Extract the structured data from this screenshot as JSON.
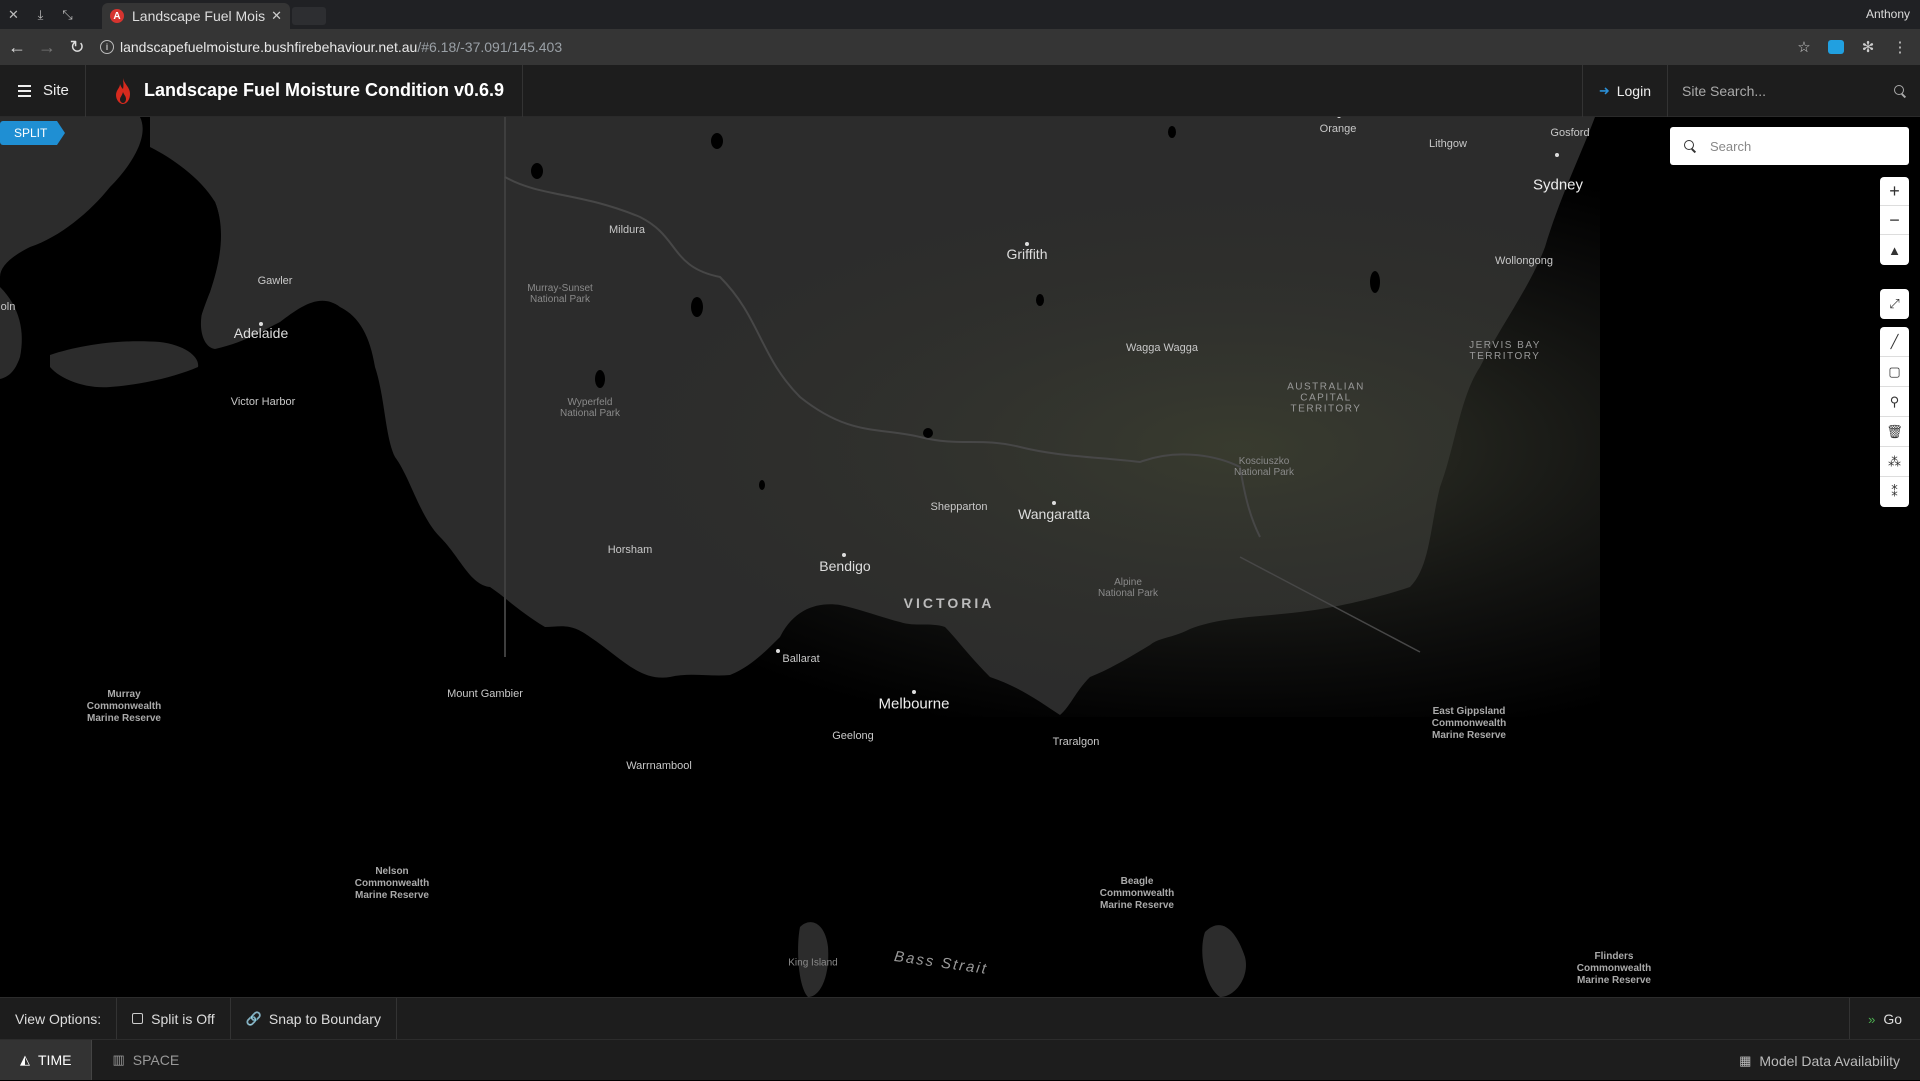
{
  "browser": {
    "tab_title": "Landscape Fuel Moist",
    "tab_favicon_letter": "A",
    "profile_name": "Anthony",
    "url_host": "landscapefuelmoisture.bushfirebehaviour.net.au",
    "url_path": "/#6.18/-37.091/145.403"
  },
  "header": {
    "site_label": "Site",
    "title": "Landscape Fuel Moisture Condition v0.6.9",
    "login_label": "Login",
    "site_search_placeholder": "Site Search...",
    "accent_color": "#1f8fd3"
  },
  "map": {
    "split_badge": "SPLIT",
    "search_placeholder": "Search",
    "controls": [
      "zoom-in-icon",
      "zoom-out-icon",
      "compass-icon",
      "fullscreen-icon",
      "draw-line-icon",
      "draw-polygon-icon",
      "marker-icon",
      "trash-icon",
      "combine-icon",
      "uncombine-icon"
    ],
    "labels": {
      "orange": "Orange",
      "lithgow": "Lithgow",
      "gosford": "Gosford",
      "sydney": "Sydney",
      "wollongong": "Wollongong",
      "mildura": "Mildura",
      "griffith": "Griffith",
      "wagga": "Wagga Wagga",
      "gawler": "Gawler",
      "adelaide": "Adelaide",
      "oln": "oln",
      "victor_harbor": "Victor Harbor",
      "murray_sunset": "Murray-Sunset\nNational Park",
      "wyperfeld": "Wyperfeld\nNational Park",
      "jervis_bay": "JERVIS BAY\nTERRITORY",
      "act": "AUSTRALIAN\nCAPITAL\nTERRITORY",
      "kosciuszko": "Kosciuszko\nNational Park",
      "shepparton": "Shepparton",
      "wangaratta": "Wangaratta",
      "horsham": "Horsham",
      "bendigo": "Bendigo",
      "victoria": "VICTORIA",
      "alpine": "Alpine\nNational Park",
      "ballarat": "Ballarat",
      "mount_gambier": "Mount Gambier",
      "melbourne": "Melbourne",
      "geelong": "Geelong",
      "traralgon": "Traralgon",
      "warrnambool": "Warrnambool",
      "murray_marine": "Murray\nCommonwealth\nMarine Reserve",
      "east_gippsland": "East Gippsland\nCommonwealth\nMarine Reserve",
      "nelson": "Nelson\nCommonwealth\nMarine Reserve",
      "beagle": "Beagle\nCommonwealth\nMarine Reserve",
      "king_island": "King Island",
      "bass_strait": "Bass Strait",
      "flinders": "Flinders\nCommonwealth\nMarine Reserve"
    }
  },
  "view_options": {
    "label": "View Options:",
    "split_label": "Split is Off",
    "snap_label": "Snap to Boundary",
    "go_label": "Go"
  },
  "bottom_tabs": {
    "time_label": "TIME",
    "space_label": "SPACE",
    "model_availability_label": "Model Data Availability"
  }
}
